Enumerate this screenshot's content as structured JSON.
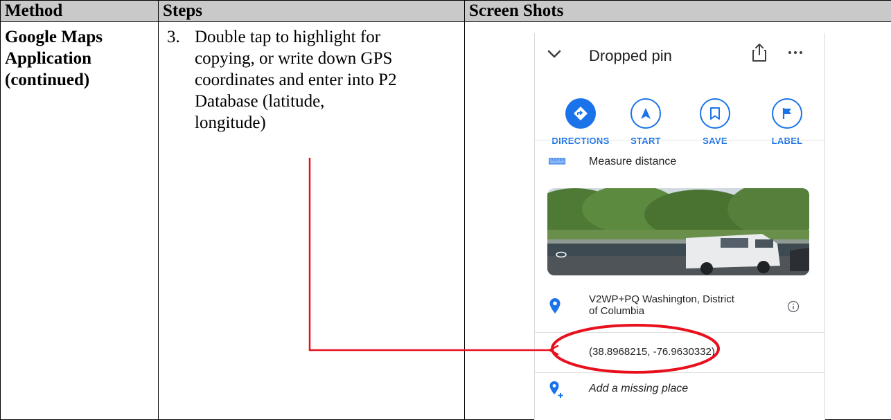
{
  "table": {
    "headers": [
      "Method",
      "Steps",
      "Screen Shots"
    ],
    "method_lines": [
      "Google Maps",
      "Application",
      "(continued)"
    ],
    "step_number": "3.",
    "step_lines": [
      "Double tap to highlight for",
      "copying, or write down GPS",
      "coordinates and enter into P2",
      "Database (latitude,",
      "longitude)"
    ]
  },
  "phone": {
    "title": "Dropped pin",
    "actions": [
      {
        "label": "DIRECTIONS",
        "icon": "directions-icon"
      },
      {
        "label": "START",
        "icon": "navigation-arrow-icon"
      },
      {
        "label": "SAVE",
        "icon": "bookmark-icon"
      },
      {
        "label": "LABEL",
        "icon": "flag-icon"
      }
    ],
    "measure_label": "Measure distance",
    "address_lines": [
      "V2WP+PQ Washington, District",
      "of Columbia"
    ],
    "coordinates": "(38.8968215, -76.9630332)",
    "add_place_label": "Add a missing place"
  },
  "colors": {
    "header_bg": "#c9c9c9",
    "maps_blue": "#1a73e8",
    "annotation_red": "#e8101c"
  }
}
